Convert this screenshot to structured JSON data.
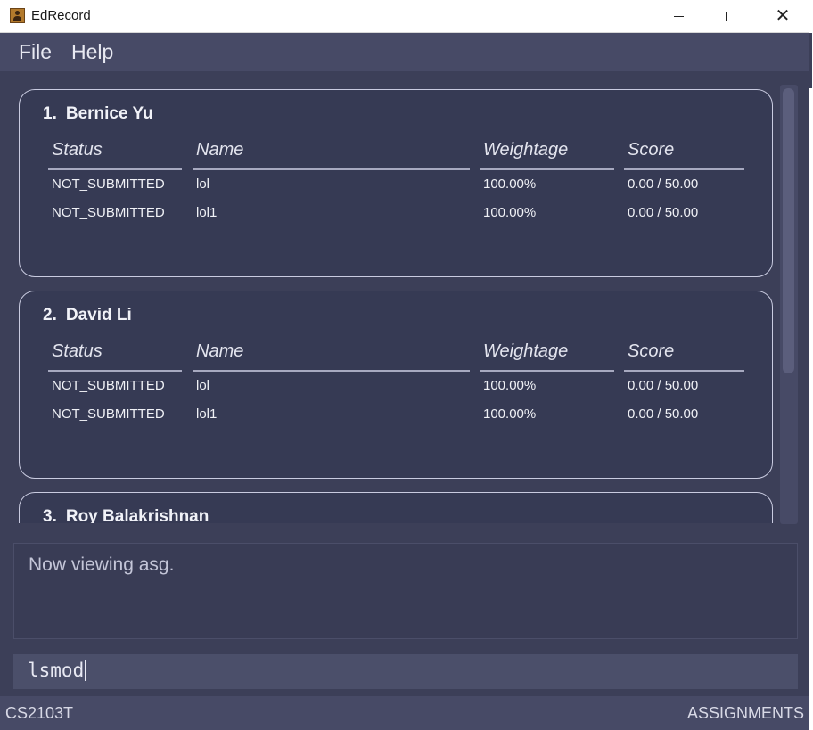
{
  "window": {
    "title": "EdRecord",
    "controls": {
      "minimize": "—",
      "maximize": "☐",
      "close": "✕"
    }
  },
  "menu": {
    "items": [
      "File",
      "Help"
    ]
  },
  "students": [
    {
      "index": "1.",
      "name": "Bernice Yu",
      "columns": [
        "Status",
        "Name",
        "Weightage",
        "Score"
      ],
      "rows": [
        {
          "status": "NOT_SUBMITTED",
          "name": "lol",
          "weightage": "100.00%",
          "score": "0.00 / 50.00"
        },
        {
          "status": "NOT_SUBMITTED",
          "name": "lol1",
          "weightage": "100.00%",
          "score": "0.00 / 50.00"
        }
      ]
    },
    {
      "index": "2.",
      "name": "David Li",
      "columns": [
        "Status",
        "Name",
        "Weightage",
        "Score"
      ],
      "rows": [
        {
          "status": "NOT_SUBMITTED",
          "name": "lol",
          "weightage": "100.00%",
          "score": "0.00 / 50.00"
        },
        {
          "status": "NOT_SUBMITTED",
          "name": "lol1",
          "weightage": "100.00%",
          "score": "0.00 / 50.00"
        }
      ]
    },
    {
      "index": "3.",
      "name": "Roy Balakrishnan"
    }
  ],
  "result": {
    "text": "Now viewing asg."
  },
  "command": {
    "value": "lsmod"
  },
  "status": {
    "module": "CS2103T",
    "view": "ASSIGNMENTS"
  },
  "colors": {
    "background": "#3c3f58",
    "card": "#363a54",
    "border": "#c9cbe0",
    "bar": "#474a66"
  },
  "icons": [
    "app-icon",
    "minimize-icon",
    "maximize-icon",
    "close-icon"
  ]
}
